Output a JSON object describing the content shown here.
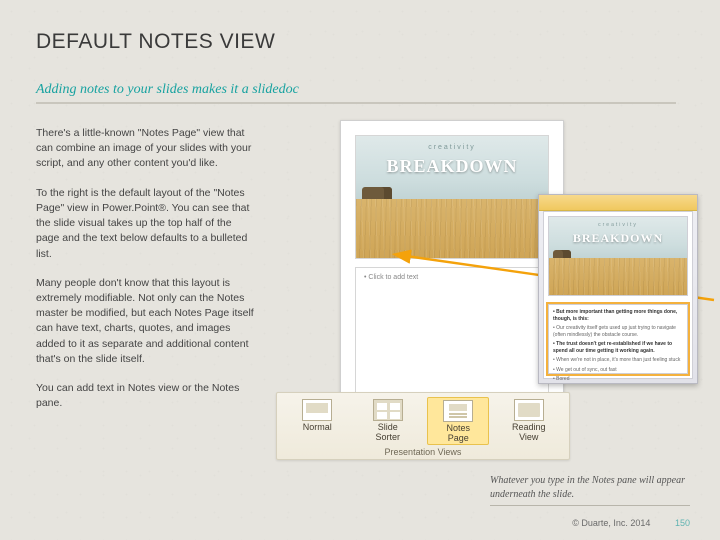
{
  "title": "DEFAULT NOTES VIEW",
  "subtitle": "Adding notes to your slides makes it a slidedoc",
  "paragraphs": {
    "p1": "There's a little-known \"Notes Page\" view that can combine an image of your slides with your script, and any other content you'd like.",
    "p2": "To the right is the default layout of the \"Notes Page\" view in Power.Point®. You can see that the slide visual takes up the top half of the page and the text below defaults to a bulleted list.",
    "p3": "Many people don't know that this layout is extremely modifiable. Not only can the Notes master be modified, but each Notes Page itself can have text, charts, quotes, and images added to it as separate and additional content that's on the slide itself.",
    "p4": "You can add text in Notes view or the Notes pane."
  },
  "slide_graphic": {
    "eyebrow": "creativity",
    "headline": "BREAKDOWN"
  },
  "notes_placeholder": "Click to add text",
  "ribbon": {
    "group_label": "Presentation Views",
    "buttons": {
      "b0": {
        "line1": "Normal",
        "line2": ""
      },
      "b1": {
        "line1": "Slide",
        "line2": "Sorter"
      },
      "b2": {
        "line1": "Notes",
        "line2": "Page"
      },
      "b3": {
        "line1": "Reading",
        "line2": "View"
      }
    },
    "selected_index": 2
  },
  "ppt_thumbnail_notes": {
    "n0": "But more important than getting more things done, though, is this:",
    "n1": "Our creativity itself gets used up just trying to navigate (often mindlessly) the obstacle course.",
    "n2": "The trust doesn't get re-established if we have to spend all our time getting it working again.",
    "n3": "When we're not in place, it's more than just feeling stuck",
    "n4": "We get out of sync, out fast",
    "n5": "Bored"
  },
  "caption": "Whatever you type in the Notes pane will appear underneath the slide.",
  "footer": {
    "copyright": "© Duarte, Inc. 2014",
    "page": "150"
  },
  "colors": {
    "accent_teal": "#17a2a0",
    "ribbon_highlight": "#ffe79b",
    "arrow": "#f4a20b"
  }
}
